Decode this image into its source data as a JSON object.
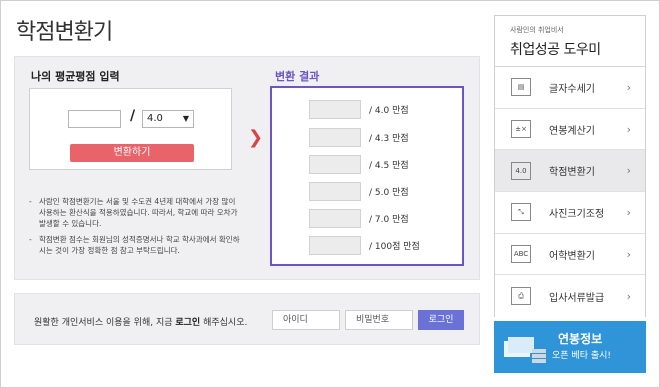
{
  "page_title": "학점변환기",
  "input_section": {
    "label": "나의 평균평점 입력",
    "gpa_value": "",
    "scale_selected": "4.0",
    "convert_button": "변환하기"
  },
  "notes": [
    "사람인 학점변환기는 서울 및 수도권 4년제 대학에서 가장 많이 사용하는 환산식을 적용하였습니다. 따라서, 학교에 따라 오차가 발생할 수 있습니다.",
    "학점변환 점수는 회원님의 성적증명서나 학교 학사과에서 확인하시는 것이 가장 정확한 점 참고 부탁드립니다."
  ],
  "result_section": {
    "label": "변환 결과",
    "rows": [
      {
        "value": "",
        "label": "/  4.0  만점"
      },
      {
        "value": "",
        "label": "/  4.3  만점"
      },
      {
        "value": "",
        "label": "/  4.5  만점"
      },
      {
        "value": "",
        "label": "/  5.0  만점"
      },
      {
        "value": "",
        "label": "/  7.0  만점"
      },
      {
        "value": "",
        "label": "/  100점  만점"
      }
    ]
  },
  "login": {
    "message_pre": "원활한 개인서비스 이용을 위해, 지금 ",
    "message_bold": "로그인",
    "message_post": " 해주십시오.",
    "id_placeholder": "아이디",
    "pw_placeholder": "비밀번호",
    "button": "로그인"
  },
  "sidebar": {
    "subtitle": "사람인의 취업비서",
    "title": "취업성공 도우미",
    "items": [
      {
        "label": "글자수세기",
        "icon": "character-count-icon",
        "glyph": "▤"
      },
      {
        "label": "연봉계산기",
        "icon": "salary-calculator-icon",
        "glyph": "±×"
      },
      {
        "label": "학점변환기",
        "icon": "grade-converter-icon",
        "glyph": "4.0",
        "active": true
      },
      {
        "label": "사진크기조정",
        "icon": "photo-resize-icon",
        "glyph": "⤡"
      },
      {
        "label": "어학변환기",
        "icon": "language-converter-icon",
        "glyph": "ABC"
      },
      {
        "label": "입사서류발급",
        "icon": "document-print-icon",
        "glyph": "⎙"
      }
    ]
  },
  "banner": {
    "title": "연봉정보",
    "subtitle": "오픈 베타 출시!"
  }
}
